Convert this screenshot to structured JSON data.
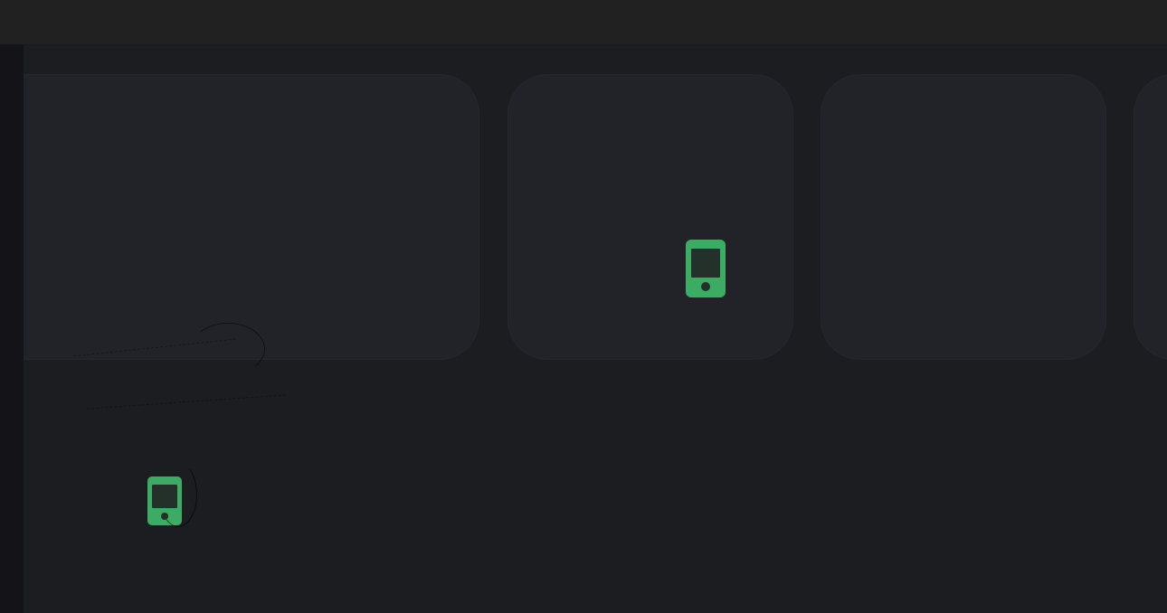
{
  "theme": {
    "background": "#1c1d21",
    "topbar": "#212121",
    "rail": "#141418",
    "card": "#222328",
    "accent": "#3cab64"
  },
  "cards": [
    {
      "id": "card-1",
      "label": ""
    },
    {
      "id": "card-2",
      "label": "",
      "icon": "smartphone-icon"
    },
    {
      "id": "card-3",
      "label": ""
    },
    {
      "id": "card-4",
      "label": ""
    }
  ],
  "floating_icon": {
    "name": "smartphone-icon"
  }
}
